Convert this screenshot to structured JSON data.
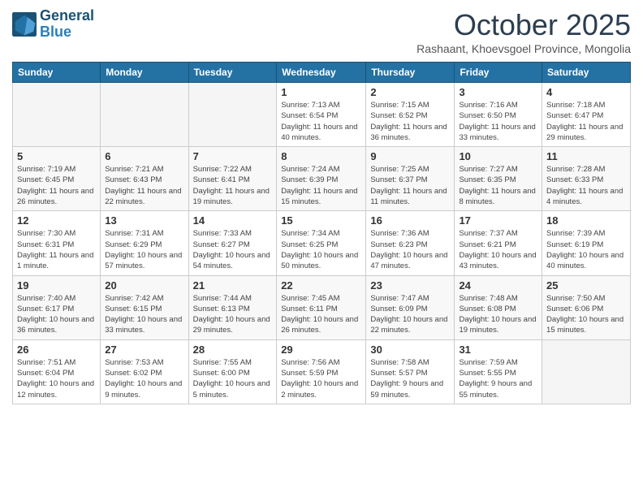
{
  "header": {
    "logo_line1": "General",
    "logo_line2": "Blue",
    "month_title": "October 2025",
    "subtitle": "Rashaant, Khoevsgoel Province, Mongolia"
  },
  "days_of_week": [
    "Sunday",
    "Monday",
    "Tuesday",
    "Wednesday",
    "Thursday",
    "Friday",
    "Saturday"
  ],
  "weeks": [
    [
      {
        "day": "",
        "info": ""
      },
      {
        "day": "",
        "info": ""
      },
      {
        "day": "",
        "info": ""
      },
      {
        "day": "1",
        "info": "Sunrise: 7:13 AM\nSunset: 6:54 PM\nDaylight: 11 hours and 40 minutes."
      },
      {
        "day": "2",
        "info": "Sunrise: 7:15 AM\nSunset: 6:52 PM\nDaylight: 11 hours and 36 minutes."
      },
      {
        "day": "3",
        "info": "Sunrise: 7:16 AM\nSunset: 6:50 PM\nDaylight: 11 hours and 33 minutes."
      },
      {
        "day": "4",
        "info": "Sunrise: 7:18 AM\nSunset: 6:47 PM\nDaylight: 11 hours and 29 minutes."
      }
    ],
    [
      {
        "day": "5",
        "info": "Sunrise: 7:19 AM\nSunset: 6:45 PM\nDaylight: 11 hours and 26 minutes."
      },
      {
        "day": "6",
        "info": "Sunrise: 7:21 AM\nSunset: 6:43 PM\nDaylight: 11 hours and 22 minutes."
      },
      {
        "day": "7",
        "info": "Sunrise: 7:22 AM\nSunset: 6:41 PM\nDaylight: 11 hours and 19 minutes."
      },
      {
        "day": "8",
        "info": "Sunrise: 7:24 AM\nSunset: 6:39 PM\nDaylight: 11 hours and 15 minutes."
      },
      {
        "day": "9",
        "info": "Sunrise: 7:25 AM\nSunset: 6:37 PM\nDaylight: 11 hours and 11 minutes."
      },
      {
        "day": "10",
        "info": "Sunrise: 7:27 AM\nSunset: 6:35 PM\nDaylight: 11 hours and 8 minutes."
      },
      {
        "day": "11",
        "info": "Sunrise: 7:28 AM\nSunset: 6:33 PM\nDaylight: 11 hours and 4 minutes."
      }
    ],
    [
      {
        "day": "12",
        "info": "Sunrise: 7:30 AM\nSunset: 6:31 PM\nDaylight: 11 hours and 1 minute."
      },
      {
        "day": "13",
        "info": "Sunrise: 7:31 AM\nSunset: 6:29 PM\nDaylight: 10 hours and 57 minutes."
      },
      {
        "day": "14",
        "info": "Sunrise: 7:33 AM\nSunset: 6:27 PM\nDaylight: 10 hours and 54 minutes."
      },
      {
        "day": "15",
        "info": "Sunrise: 7:34 AM\nSunset: 6:25 PM\nDaylight: 10 hours and 50 minutes."
      },
      {
        "day": "16",
        "info": "Sunrise: 7:36 AM\nSunset: 6:23 PM\nDaylight: 10 hours and 47 minutes."
      },
      {
        "day": "17",
        "info": "Sunrise: 7:37 AM\nSunset: 6:21 PM\nDaylight: 10 hours and 43 minutes."
      },
      {
        "day": "18",
        "info": "Sunrise: 7:39 AM\nSunset: 6:19 PM\nDaylight: 10 hours and 40 minutes."
      }
    ],
    [
      {
        "day": "19",
        "info": "Sunrise: 7:40 AM\nSunset: 6:17 PM\nDaylight: 10 hours and 36 minutes."
      },
      {
        "day": "20",
        "info": "Sunrise: 7:42 AM\nSunset: 6:15 PM\nDaylight: 10 hours and 33 minutes."
      },
      {
        "day": "21",
        "info": "Sunrise: 7:44 AM\nSunset: 6:13 PM\nDaylight: 10 hours and 29 minutes."
      },
      {
        "day": "22",
        "info": "Sunrise: 7:45 AM\nSunset: 6:11 PM\nDaylight: 10 hours and 26 minutes."
      },
      {
        "day": "23",
        "info": "Sunrise: 7:47 AM\nSunset: 6:09 PM\nDaylight: 10 hours and 22 minutes."
      },
      {
        "day": "24",
        "info": "Sunrise: 7:48 AM\nSunset: 6:08 PM\nDaylight: 10 hours and 19 minutes."
      },
      {
        "day": "25",
        "info": "Sunrise: 7:50 AM\nSunset: 6:06 PM\nDaylight: 10 hours and 15 minutes."
      }
    ],
    [
      {
        "day": "26",
        "info": "Sunrise: 7:51 AM\nSunset: 6:04 PM\nDaylight: 10 hours and 12 minutes."
      },
      {
        "day": "27",
        "info": "Sunrise: 7:53 AM\nSunset: 6:02 PM\nDaylight: 10 hours and 9 minutes."
      },
      {
        "day": "28",
        "info": "Sunrise: 7:55 AM\nSunset: 6:00 PM\nDaylight: 10 hours and 5 minutes."
      },
      {
        "day": "29",
        "info": "Sunrise: 7:56 AM\nSunset: 5:59 PM\nDaylight: 10 hours and 2 minutes."
      },
      {
        "day": "30",
        "info": "Sunrise: 7:58 AM\nSunset: 5:57 PM\nDaylight: 9 hours and 59 minutes."
      },
      {
        "day": "31",
        "info": "Sunrise: 7:59 AM\nSunset: 5:55 PM\nDaylight: 9 hours and 55 minutes."
      },
      {
        "day": "",
        "info": ""
      }
    ]
  ]
}
